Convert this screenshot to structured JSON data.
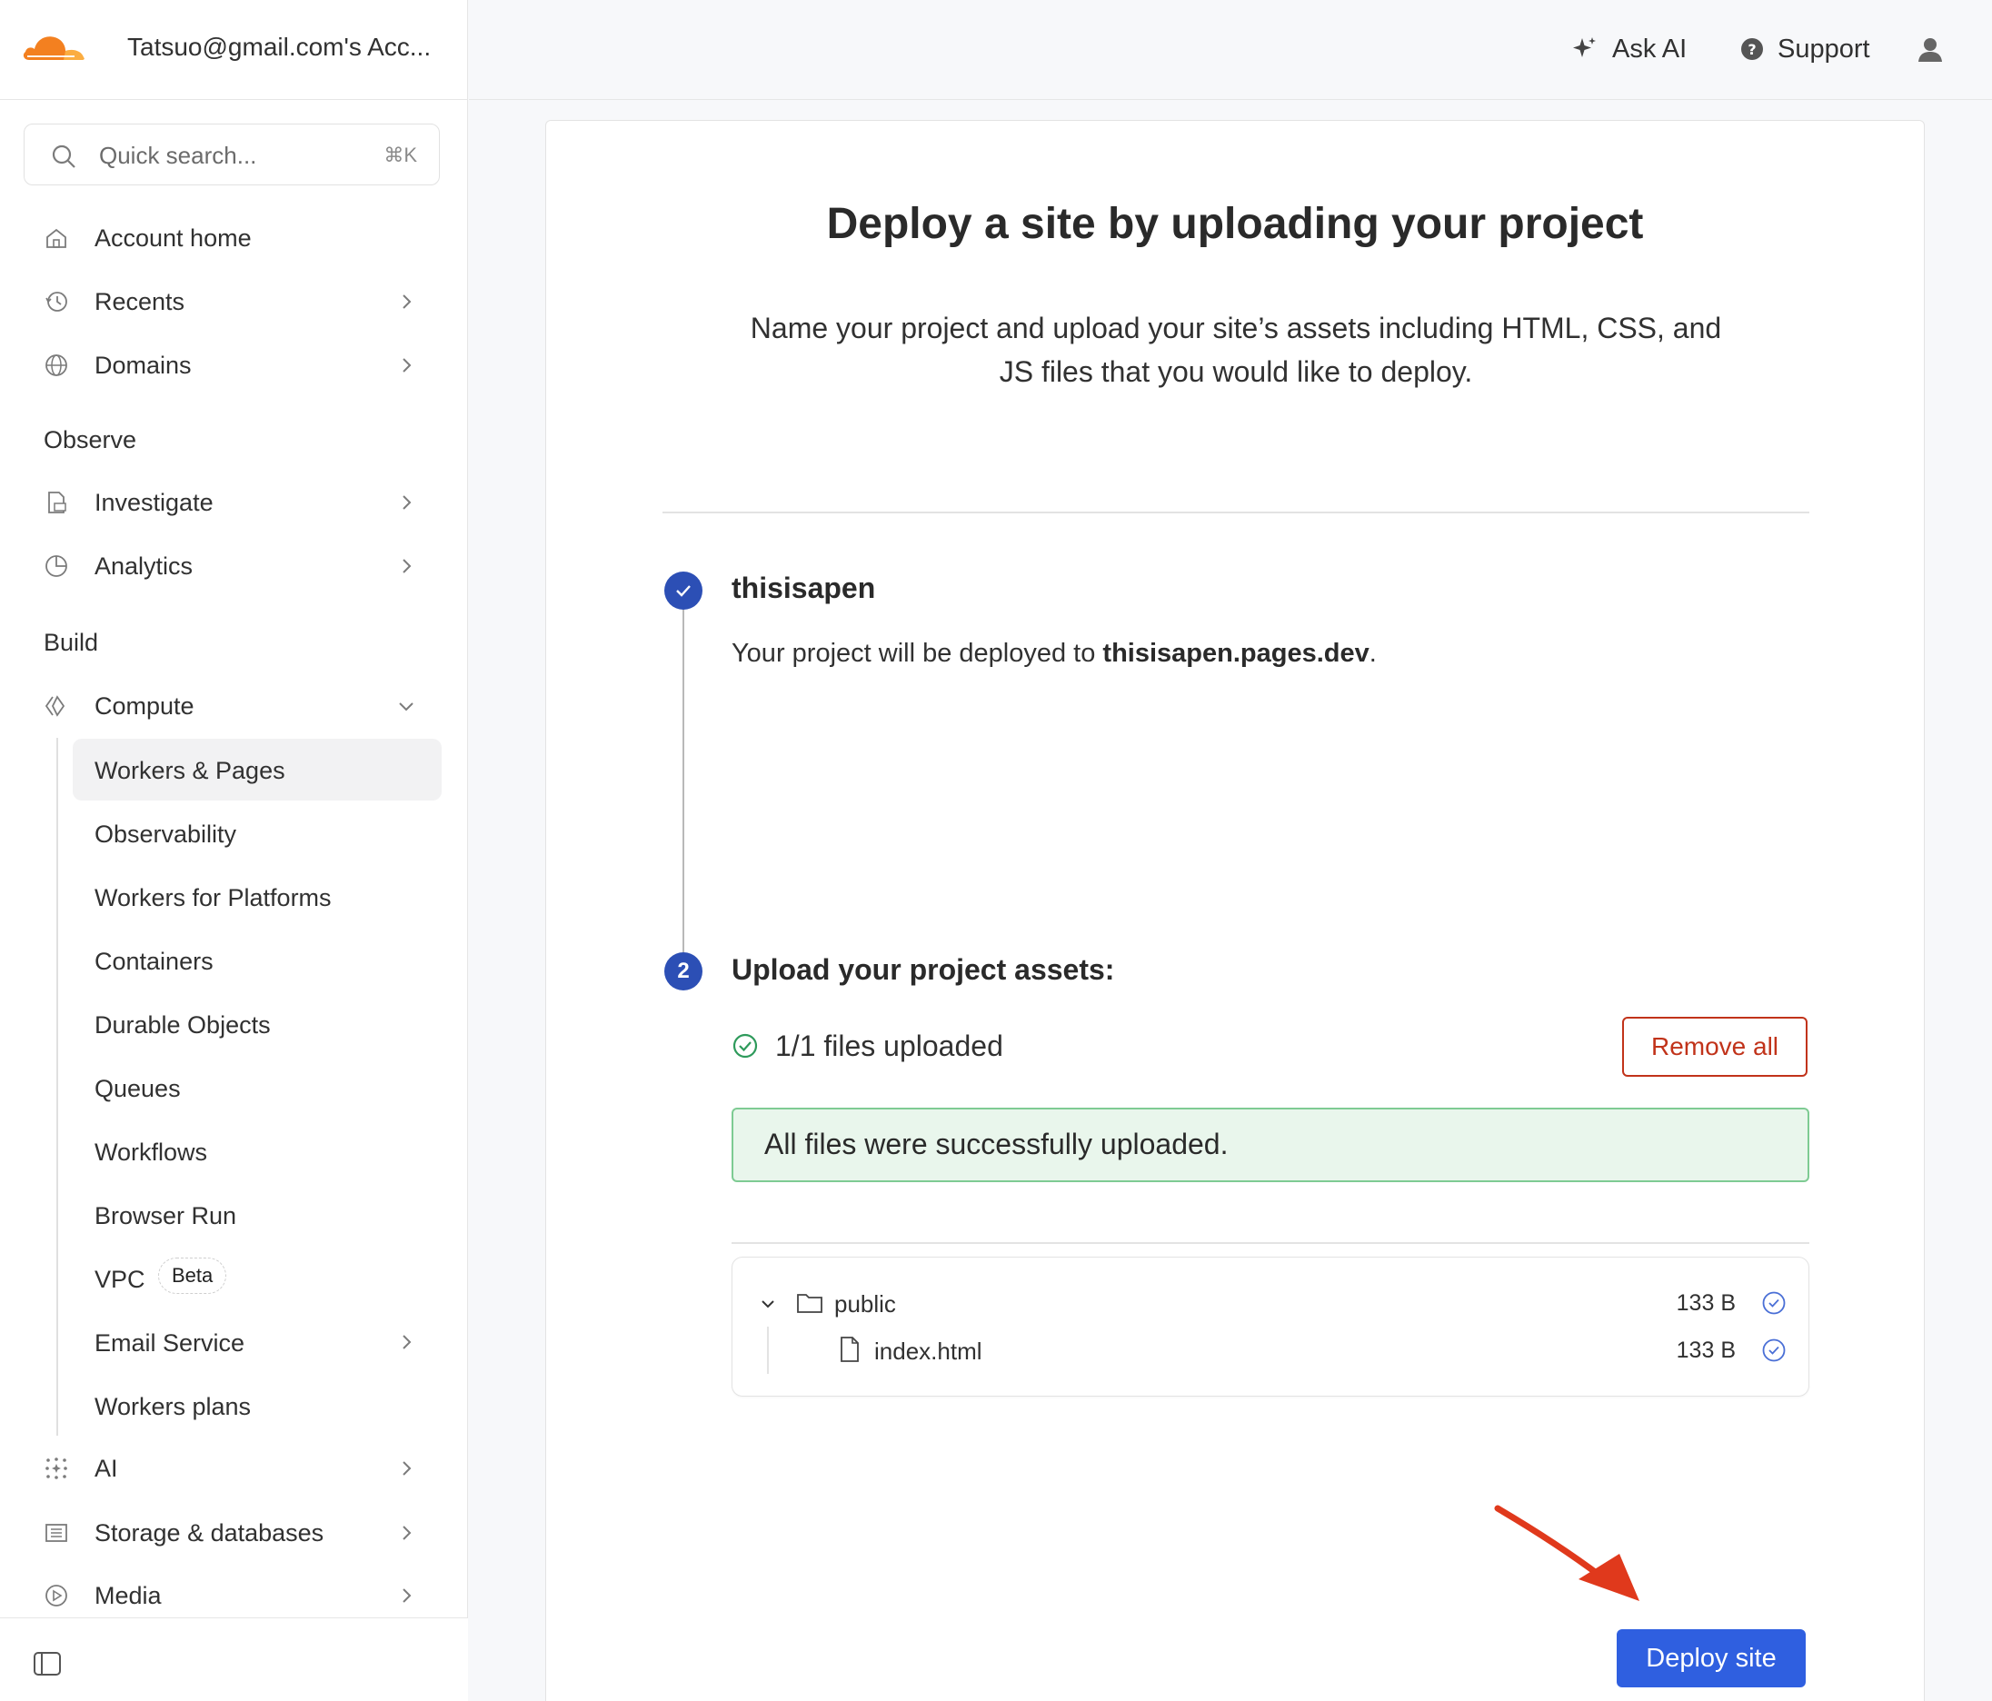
{
  "account": {
    "name": "Tatsuo@gmail.com's Acc..."
  },
  "search": {
    "placeholder": "Quick search...",
    "shortcut": "⌘K"
  },
  "sidebar": {
    "items": [
      {
        "label": "Account home",
        "icon": "home-icon"
      },
      {
        "label": "Recents",
        "icon": "history-icon"
      },
      {
        "label": "Domains",
        "icon": "globe-icon"
      }
    ],
    "sections": {
      "observe": "Observe",
      "build": "Build"
    },
    "observe_items": [
      {
        "label": "Investigate",
        "icon": "document-search-icon"
      },
      {
        "label": "Analytics",
        "icon": "pie-chart-icon"
      }
    ],
    "compute": {
      "label": "Compute",
      "icon": "compute-icon"
    },
    "compute_items": [
      {
        "label": "Workers & Pages",
        "active": true
      },
      {
        "label": "Observability"
      },
      {
        "label": "Workers for Platforms"
      },
      {
        "label": "Containers"
      },
      {
        "label": "Durable Objects"
      },
      {
        "label": "Queues"
      },
      {
        "label": "Workflows"
      },
      {
        "label": "Browser Run"
      },
      {
        "label": "VPC",
        "badge": "Beta"
      },
      {
        "label": "Email Service"
      },
      {
        "label": "Workers plans"
      }
    ],
    "more_items": [
      {
        "label": "AI",
        "icon": "sparkle-grid-icon"
      },
      {
        "label": "Storage & databases",
        "icon": "storage-icon"
      },
      {
        "label": "Media",
        "icon": "play-icon"
      }
    ]
  },
  "topbar": {
    "ask_ai": "Ask AI",
    "support": "Support"
  },
  "main": {
    "title": "Deploy a site by uploading your project",
    "subtitle": "Name your project and upload your site’s assets including HTML, CSS, and JS files that you would like to deploy.",
    "step1": {
      "project_name": "thisisapen",
      "desc_prefix": "Your project will be deployed to ",
      "domain": "thisisapen.pages.dev",
      "desc_suffix": "."
    },
    "step2": {
      "number": "2",
      "title": "Upload your project assets:",
      "status": "1/1 files uploaded",
      "remove_all": "Remove all",
      "success": "All files were successfully uploaded.",
      "files": [
        {
          "name": "public",
          "size": "133 B",
          "type": "folder"
        },
        {
          "name": "index.html",
          "size": "133 B",
          "type": "file"
        }
      ]
    },
    "deploy_button": "Deploy site"
  },
  "colors": {
    "accent": "#2f5fe0",
    "step": "#2c4fb5",
    "danger": "#c1331a",
    "success_bg": "#e9f6ec",
    "success_border": "#7ecb93",
    "brand": "#f38020"
  }
}
